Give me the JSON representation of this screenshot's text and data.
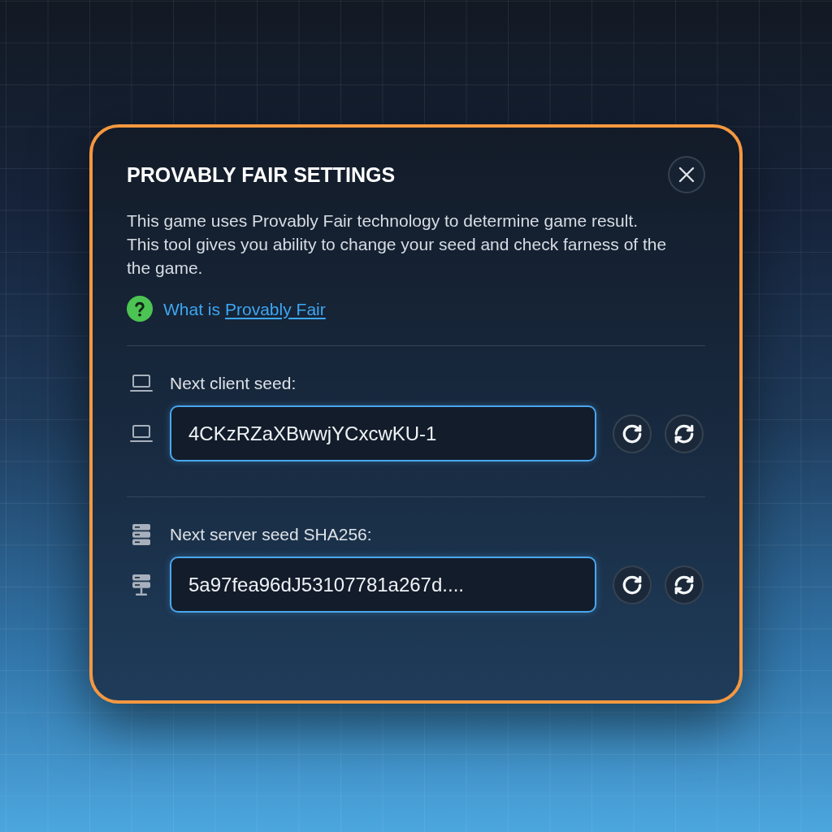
{
  "dialog": {
    "title": "PROVABLY FAIR SETTINGS",
    "description": [
      "This game uses Provably Fair technology to determine game result.",
      "This tool gives you ability to change your seed and check farness of the the game."
    ],
    "help_link": {
      "prefix": "What is",
      "link": "Provably Fair"
    }
  },
  "seeds": [
    {
      "kind": "client",
      "label": "Next client seed:",
      "value": "4CKzRZaXBwwjYCxcwKU-1"
    },
    {
      "kind": "server",
      "label": "Next server seed SHA256:",
      "value": "5a97fea96dJ53107781a267d...."
    }
  ]
}
